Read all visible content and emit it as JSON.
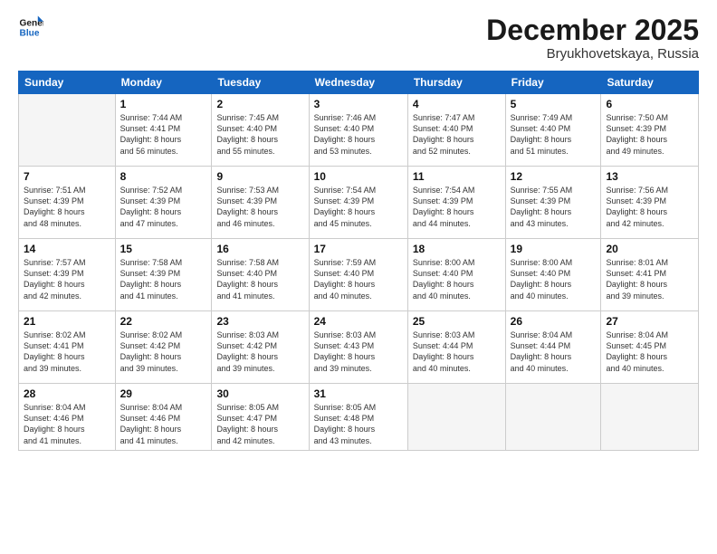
{
  "logo": {
    "line1": "General",
    "line2": "Blue"
  },
  "title": "December 2025",
  "subtitle": "Bryukhovetskaya, Russia",
  "weekdays": [
    "Sunday",
    "Monday",
    "Tuesday",
    "Wednesday",
    "Thursday",
    "Friday",
    "Saturday"
  ],
  "weeks": [
    [
      {
        "day": "",
        "info": ""
      },
      {
        "day": "1",
        "info": "Sunrise: 7:44 AM\nSunset: 4:41 PM\nDaylight: 8 hours\nand 56 minutes."
      },
      {
        "day": "2",
        "info": "Sunrise: 7:45 AM\nSunset: 4:40 PM\nDaylight: 8 hours\nand 55 minutes."
      },
      {
        "day": "3",
        "info": "Sunrise: 7:46 AM\nSunset: 4:40 PM\nDaylight: 8 hours\nand 53 minutes."
      },
      {
        "day": "4",
        "info": "Sunrise: 7:47 AM\nSunset: 4:40 PM\nDaylight: 8 hours\nand 52 minutes."
      },
      {
        "day": "5",
        "info": "Sunrise: 7:49 AM\nSunset: 4:40 PM\nDaylight: 8 hours\nand 51 minutes."
      },
      {
        "day": "6",
        "info": "Sunrise: 7:50 AM\nSunset: 4:39 PM\nDaylight: 8 hours\nand 49 minutes."
      }
    ],
    [
      {
        "day": "7",
        "info": "Sunrise: 7:51 AM\nSunset: 4:39 PM\nDaylight: 8 hours\nand 48 minutes."
      },
      {
        "day": "8",
        "info": "Sunrise: 7:52 AM\nSunset: 4:39 PM\nDaylight: 8 hours\nand 47 minutes."
      },
      {
        "day": "9",
        "info": "Sunrise: 7:53 AM\nSunset: 4:39 PM\nDaylight: 8 hours\nand 46 minutes."
      },
      {
        "day": "10",
        "info": "Sunrise: 7:54 AM\nSunset: 4:39 PM\nDaylight: 8 hours\nand 45 minutes."
      },
      {
        "day": "11",
        "info": "Sunrise: 7:54 AM\nSunset: 4:39 PM\nDaylight: 8 hours\nand 44 minutes."
      },
      {
        "day": "12",
        "info": "Sunrise: 7:55 AM\nSunset: 4:39 PM\nDaylight: 8 hours\nand 43 minutes."
      },
      {
        "day": "13",
        "info": "Sunrise: 7:56 AM\nSunset: 4:39 PM\nDaylight: 8 hours\nand 42 minutes."
      }
    ],
    [
      {
        "day": "14",
        "info": "Sunrise: 7:57 AM\nSunset: 4:39 PM\nDaylight: 8 hours\nand 42 minutes."
      },
      {
        "day": "15",
        "info": "Sunrise: 7:58 AM\nSunset: 4:39 PM\nDaylight: 8 hours\nand 41 minutes."
      },
      {
        "day": "16",
        "info": "Sunrise: 7:58 AM\nSunset: 4:40 PM\nDaylight: 8 hours\nand 41 minutes."
      },
      {
        "day": "17",
        "info": "Sunrise: 7:59 AM\nSunset: 4:40 PM\nDaylight: 8 hours\nand 40 minutes."
      },
      {
        "day": "18",
        "info": "Sunrise: 8:00 AM\nSunset: 4:40 PM\nDaylight: 8 hours\nand 40 minutes."
      },
      {
        "day": "19",
        "info": "Sunrise: 8:00 AM\nSunset: 4:40 PM\nDaylight: 8 hours\nand 40 minutes."
      },
      {
        "day": "20",
        "info": "Sunrise: 8:01 AM\nSunset: 4:41 PM\nDaylight: 8 hours\nand 39 minutes."
      }
    ],
    [
      {
        "day": "21",
        "info": "Sunrise: 8:02 AM\nSunset: 4:41 PM\nDaylight: 8 hours\nand 39 minutes."
      },
      {
        "day": "22",
        "info": "Sunrise: 8:02 AM\nSunset: 4:42 PM\nDaylight: 8 hours\nand 39 minutes."
      },
      {
        "day": "23",
        "info": "Sunrise: 8:03 AM\nSunset: 4:42 PM\nDaylight: 8 hours\nand 39 minutes."
      },
      {
        "day": "24",
        "info": "Sunrise: 8:03 AM\nSunset: 4:43 PM\nDaylight: 8 hours\nand 39 minutes."
      },
      {
        "day": "25",
        "info": "Sunrise: 8:03 AM\nSunset: 4:44 PM\nDaylight: 8 hours\nand 40 minutes."
      },
      {
        "day": "26",
        "info": "Sunrise: 8:04 AM\nSunset: 4:44 PM\nDaylight: 8 hours\nand 40 minutes."
      },
      {
        "day": "27",
        "info": "Sunrise: 8:04 AM\nSunset: 4:45 PM\nDaylight: 8 hours\nand 40 minutes."
      }
    ],
    [
      {
        "day": "28",
        "info": "Sunrise: 8:04 AM\nSunset: 4:46 PM\nDaylight: 8 hours\nand 41 minutes."
      },
      {
        "day": "29",
        "info": "Sunrise: 8:04 AM\nSunset: 4:46 PM\nDaylight: 8 hours\nand 41 minutes."
      },
      {
        "day": "30",
        "info": "Sunrise: 8:05 AM\nSunset: 4:47 PM\nDaylight: 8 hours\nand 42 minutes."
      },
      {
        "day": "31",
        "info": "Sunrise: 8:05 AM\nSunset: 4:48 PM\nDaylight: 8 hours\nand 43 minutes."
      },
      {
        "day": "",
        "info": ""
      },
      {
        "day": "",
        "info": ""
      },
      {
        "day": "",
        "info": ""
      }
    ]
  ]
}
